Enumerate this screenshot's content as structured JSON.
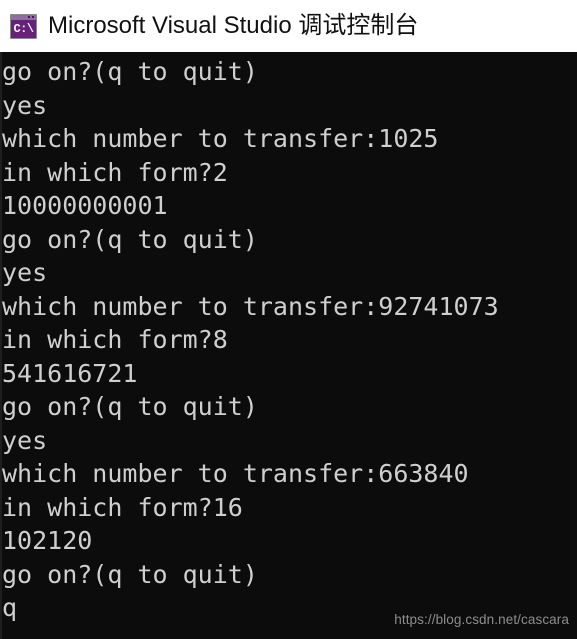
{
  "window": {
    "title": "Microsoft Visual Studio 调试控制台",
    "icon_name": "console-app-icon",
    "icon_text": "C:\\",
    "titlebar_bg": "#ffffff",
    "title_color": "#111111",
    "icon_color": "#68217a"
  },
  "console": {
    "background": "#0c0c0c",
    "text_color": "#cccccc",
    "lines": [
      "go on?(q to quit)",
      "yes",
      "which number to transfer:1025",
      "in which form?2",
      "10000000001",
      "go on?(q to quit)",
      "yes",
      "which number to transfer:92741073",
      "in which form?8",
      "541616721",
      "go on?(q to quit)",
      "yes",
      "which number to transfer:663840",
      "in which form?16",
      "102120",
      "go on?(q to quit)",
      "q"
    ],
    "sessions": [
      {
        "prompt_continue": "go on?(q to quit)",
        "answer_continue": "yes",
        "prompt_number": "which number to transfer:",
        "input_number": "1025",
        "prompt_form": "in which form?",
        "input_form": "2",
        "result": "10000000001"
      },
      {
        "prompt_continue": "go on?(q to quit)",
        "answer_continue": "yes",
        "prompt_number": "which number to transfer:",
        "input_number": "92741073",
        "prompt_form": "in which form?",
        "input_form": "8",
        "result": "541616721"
      },
      {
        "prompt_continue": "go on?(q to quit)",
        "answer_continue": "yes",
        "prompt_number": "which number to transfer:",
        "input_number": "663840",
        "prompt_form": "in which form?",
        "input_form": "16",
        "result": "102120"
      }
    ],
    "final_prompt": "go on?(q to quit)",
    "final_input": "q"
  },
  "watermark": {
    "text": "https://blog.csdn.net/cascara",
    "color": "#8d8d8d"
  }
}
